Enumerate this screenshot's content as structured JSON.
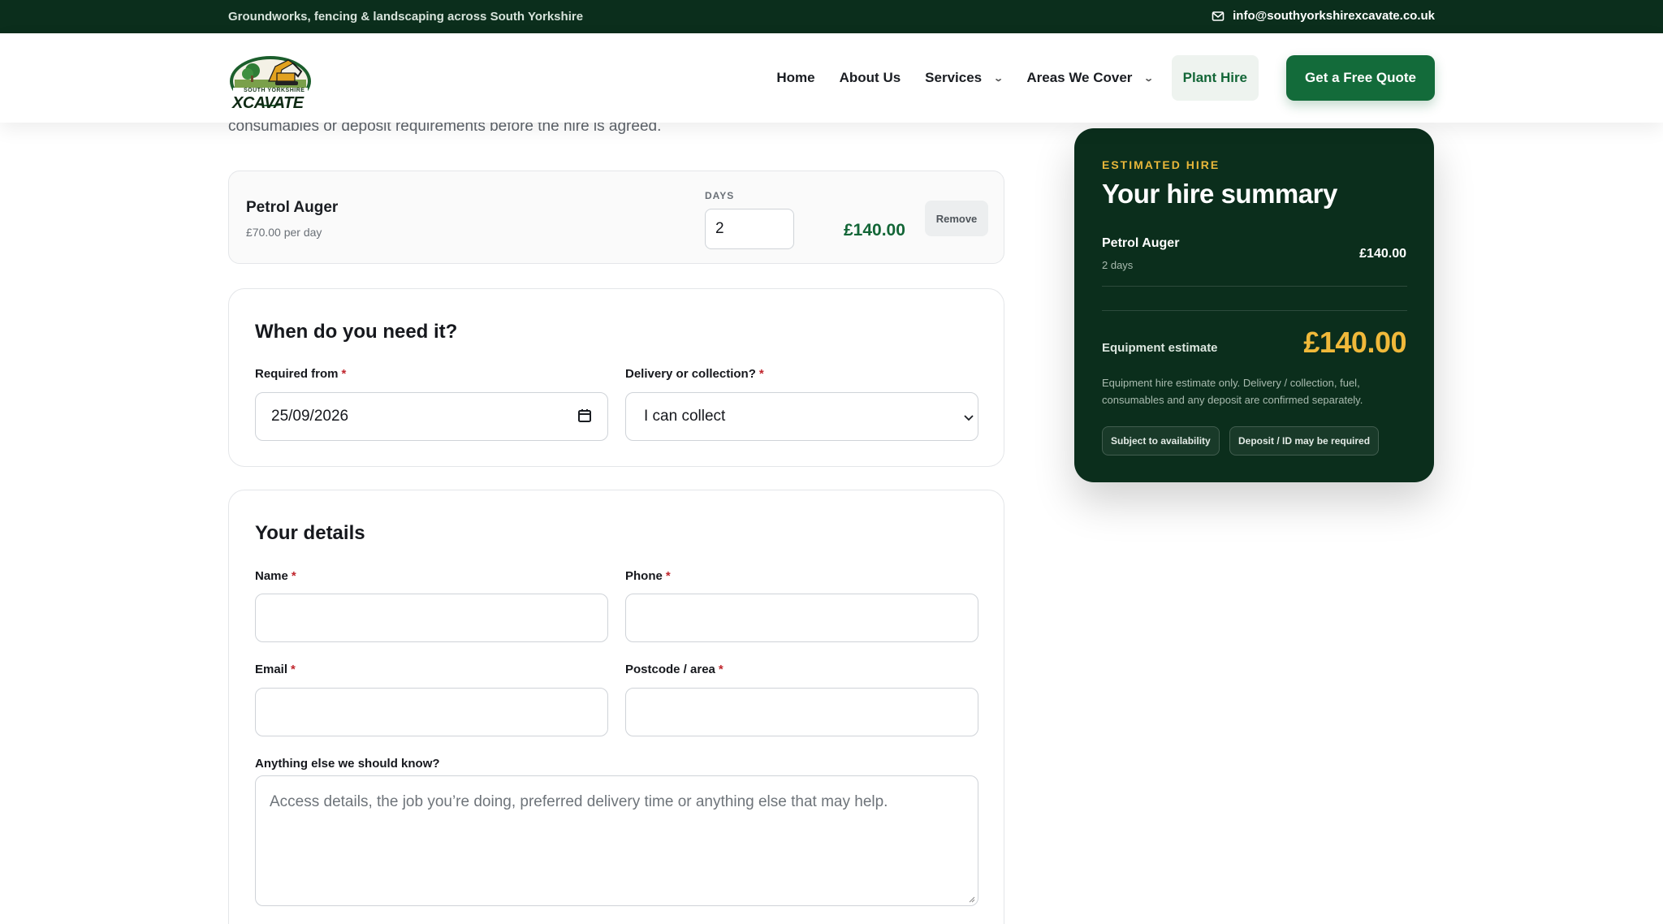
{
  "topbar": {
    "tagline": "Groundworks, fencing & landscaping across South Yorkshire",
    "email": "info@southyorkshirexcavate.co.uk"
  },
  "brand": {
    "logo_top": "SOUTH YORKSHIRE",
    "logo_main": "XCAVATE"
  },
  "nav": {
    "home": "Home",
    "about": "About Us",
    "services": "Services",
    "areas": "Areas We Cover",
    "plant_hire": "Plant Hire",
    "quote": "Get a Free Quote"
  },
  "intro_text": "consumables or deposit requirements before the hire is agreed.",
  "hire_item": {
    "name": "Petrol Auger",
    "rate": "£70.00 per day",
    "days_label": "DAYS",
    "days_value": "2",
    "price": "£140.00",
    "remove_label": "Remove"
  },
  "when": {
    "title": "When do you need it?",
    "required_from_label": "Required from",
    "required_from_value": "25/09/2026",
    "delivery_label": "Delivery or collection?",
    "delivery_value": "I can collect",
    "required_marker": "*"
  },
  "details": {
    "title": "Your details",
    "name_label": "Name",
    "phone_label": "Phone",
    "email_label": "Email",
    "postcode_label": "Postcode / area",
    "notes_label": "Anything else we should know?",
    "notes_placeholder": "Access details, the job you’re doing, preferred delivery time or anything else that may help.",
    "required_marker": "*"
  },
  "summary": {
    "eyebrow": "ESTIMATED HIRE",
    "title": "Your hire summary",
    "line_name": "Petrol Auger",
    "line_days": "2 days",
    "line_price": "£140.00",
    "estimate_label": "Equipment estimate",
    "estimate_total": "£140.00",
    "note": "Equipment hire estimate only. Delivery / collection, fuel, consumables and any deposit are confirmed separately.",
    "pill_availability": "Subject to availability",
    "pill_deposit": "Deposit / ID may be required"
  },
  "colors": {
    "dark_green": "#0b2e1c",
    "brand_green": "#136b3a",
    "gold": "#f0b93a",
    "required_red": "#c0262d"
  },
  "icons": {
    "email": "envelope-icon",
    "calendar": "calendar-icon",
    "dropdown": "chevron-down-icon"
  }
}
